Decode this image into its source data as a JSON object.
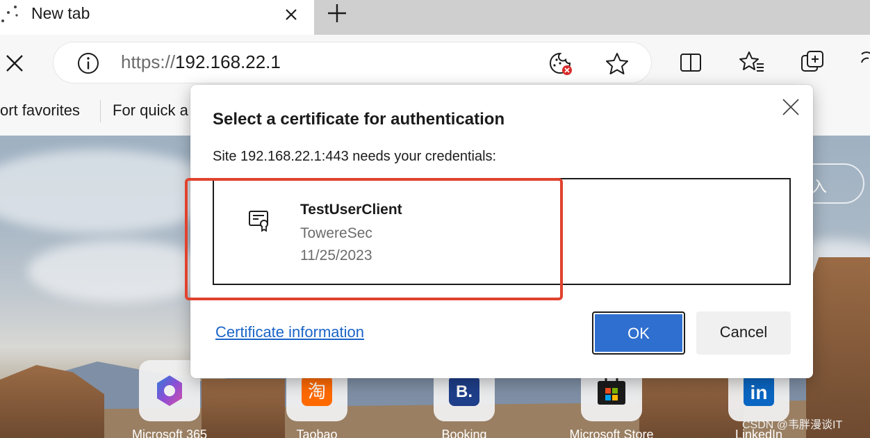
{
  "tab": {
    "title": "New tab",
    "loading_icon": "loading-dots-icon",
    "close_icon": "close-icon"
  },
  "new_tab_icon": "plus-icon",
  "address_bar": {
    "url_scheme": "https://",
    "url_host": "192.168.22.1",
    "info_icon": "info-icon",
    "cookie_icon": "cookie-blocked-icon",
    "favorite_icon": "star-icon"
  },
  "toolbar_icons": [
    "split-screen-icon",
    "favorites-icon",
    "collections-icon",
    "copilot-icon"
  ],
  "favorites_bar": {
    "item_1": "ort favorites",
    "item_2": "For quick a"
  },
  "ntp": {
    "signin_label": "入",
    "quick_links": [
      {
        "label": "Microsoft 365",
        "icon": "microsoft-365-icon"
      },
      {
        "label": "Taobao",
        "icon": "taobao-icon"
      },
      {
        "label": "Booking",
        "icon": "booking-icon"
      },
      {
        "label": "Microsoft Store",
        "icon": "microsoft-store-icon"
      },
      {
        "label": "LinkedIn",
        "icon": "linkedin-icon"
      }
    ],
    "watermark": "CSDN @韦胖漫谈IT"
  },
  "dialog": {
    "title": "Select a certificate for authentication",
    "subtitle": "Site 192.168.22.1:443 needs your credentials:",
    "certificates": [
      {
        "name": "TestUserClient",
        "issuer": "TowereSec",
        "expires": "11/25/2023",
        "icon": "certificate-icon"
      }
    ],
    "cert_info_link": "Certificate information",
    "ok_label": "OK",
    "cancel_label": "Cancel",
    "highlight_color": "#e0422d",
    "accent_color": "#2f6fcf"
  }
}
